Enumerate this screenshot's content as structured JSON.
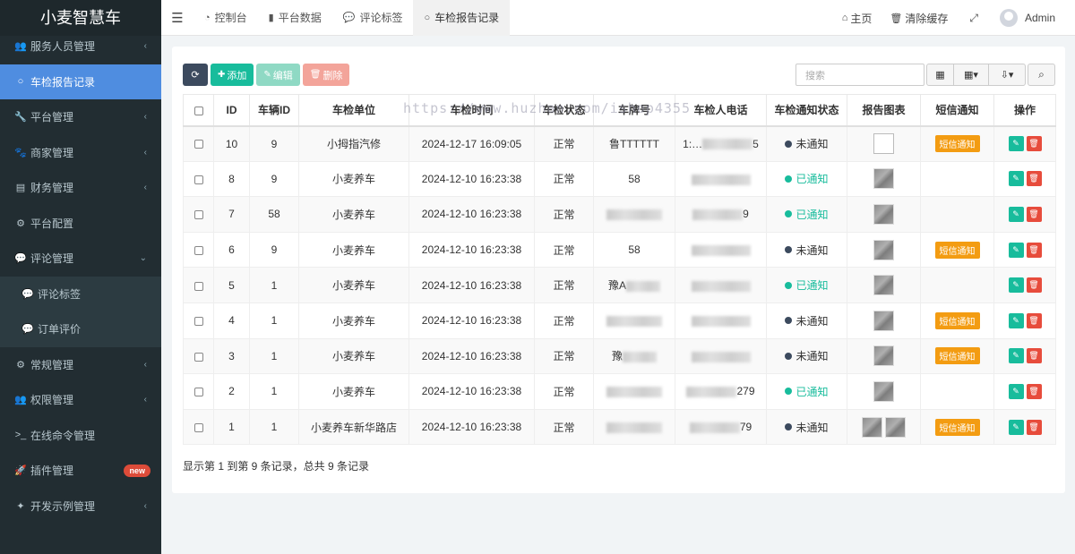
{
  "app": {
    "title": "小麦智慧车"
  },
  "sidebar": {
    "items": [
      {
        "label": "服务人员管理",
        "icon": "users-icon",
        "glyph": "👥",
        "arrow": true
      },
      {
        "label": "车检报告记录",
        "icon": "circle-icon",
        "glyph": "○",
        "active": true
      },
      {
        "label": "平台管理",
        "icon": "wrench-icon",
        "glyph": "🔧",
        "arrow": true
      },
      {
        "label": "商家管理",
        "icon": "paw-icon",
        "glyph": "🐾",
        "arrow": true
      },
      {
        "label": "财务管理",
        "icon": "money-icon",
        "glyph": "▤",
        "arrow": true
      },
      {
        "label": "平台配置",
        "icon": "cogs-icon",
        "glyph": "⚙"
      },
      {
        "label": "评论管理",
        "icon": "comments-icon",
        "glyph": "💬",
        "arrow": true,
        "expanded": true
      },
      {
        "label": "评论标签",
        "icon": "comments-icon",
        "glyph": "💬",
        "sub": true
      },
      {
        "label": "订单评价",
        "icon": "comment-icon",
        "glyph": "💬",
        "sub": true
      },
      {
        "label": "常规管理",
        "icon": "cogs-icon",
        "glyph": "⚙",
        "arrow": true
      },
      {
        "label": "权限管理",
        "icon": "group-icon",
        "glyph": "👥",
        "arrow": true
      },
      {
        "label": "在线命令管理",
        "icon": "terminal-icon",
        "glyph": ">_"
      },
      {
        "label": "插件管理",
        "icon": "rocket-icon",
        "glyph": "🚀",
        "badge": "new"
      },
      {
        "label": "开发示例管理",
        "icon": "magic-icon",
        "glyph": "✦",
        "arrow": true
      }
    ]
  },
  "header": {
    "tabs": [
      {
        "label": "控制台",
        "icon": "dashboard-icon",
        "glyph": "◔"
      },
      {
        "label": "平台数据",
        "icon": "bar-chart-icon",
        "glyph": "▮"
      },
      {
        "label": "评论标签",
        "icon": "comments-icon",
        "glyph": "💬"
      },
      {
        "label": "车检报告记录",
        "icon": "circle-icon",
        "glyph": "○",
        "active": true
      }
    ],
    "home_label": "主页",
    "clear_cache_label": "清除缓存",
    "user_name": "Admin"
  },
  "toolbar": {
    "add_label": "添加",
    "edit_label": "编辑",
    "delete_label": "删除",
    "search_placeholder": "搜索"
  },
  "watermark": "https://www.huzhan.com/ishop4355",
  "table": {
    "columns": [
      "ID",
      "车辆ID",
      "车检单位",
      "车检时间",
      "车检状态",
      "车牌号",
      "车检人电话",
      "车检通知状态",
      "报告图表",
      "短信通知",
      "操作"
    ],
    "rows": [
      {
        "id": "10",
        "car_id": "9",
        "unit": "小拇指汽修",
        "time": "2024-12-17 16:09:05",
        "status": "正常",
        "plate": "鲁TTTTTT",
        "plate_blur": false,
        "phone": "1:…",
        "phone_tail": "5",
        "notify": "未通知",
        "notified": false,
        "images": "broken",
        "sms": "短信通知"
      },
      {
        "id": "8",
        "car_id": "9",
        "unit": "小麦养车",
        "time": "2024-12-10 16:23:38",
        "status": "正常",
        "plate": "58",
        "plate_blur": false,
        "phone": "",
        "phone_tail": "",
        "notify": "已通知",
        "notified": true,
        "images": "1",
        "sms": ""
      },
      {
        "id": "7",
        "car_id": "58",
        "unit": "小麦养车",
        "time": "2024-12-10 16:23:38",
        "status": "正常",
        "plate": "",
        "plate_blur": true,
        "phone": "",
        "phone_tail": "9",
        "notify": "已通知",
        "notified": true,
        "images": "1",
        "sms": ""
      },
      {
        "id": "6",
        "car_id": "9",
        "unit": "小麦养车",
        "time": "2024-12-10 16:23:38",
        "status": "正常",
        "plate": "58",
        "plate_blur": false,
        "phone": "",
        "phone_tail": "",
        "notify": "未通知",
        "notified": false,
        "images": "1",
        "sms": "短信通知"
      },
      {
        "id": "5",
        "car_id": "1",
        "unit": "小麦养车",
        "time": "2024-12-10 16:23:38",
        "status": "正常",
        "plate": "豫A",
        "plate_blur": true,
        "phone": "",
        "phone_tail": "",
        "notify": "已通知",
        "notified": true,
        "images": "1",
        "sms": ""
      },
      {
        "id": "4",
        "car_id": "1",
        "unit": "小麦养车",
        "time": "2024-12-10 16:23:38",
        "status": "正常",
        "plate": "",
        "plate_blur": true,
        "phone": "",
        "phone_tail": "",
        "notify": "未通知",
        "notified": false,
        "images": "1",
        "sms": "短信通知"
      },
      {
        "id": "3",
        "car_id": "1",
        "unit": "小麦养车",
        "time": "2024-12-10 16:23:38",
        "status": "正常",
        "plate": "豫",
        "plate_blur": true,
        "phone": "",
        "phone_tail": "",
        "notify": "未通知",
        "notified": false,
        "images": "1",
        "sms": "短信通知"
      },
      {
        "id": "2",
        "car_id": "1",
        "unit": "小麦养车",
        "time": "2024-12-10 16:23:38",
        "status": "正常",
        "plate": "",
        "plate_blur": true,
        "phone": "",
        "phone_tail": "279",
        "notify": "已通知",
        "notified": true,
        "images": "1",
        "sms": ""
      },
      {
        "id": "1",
        "car_id": "1",
        "unit": "小麦养车新华路店",
        "time": "2024-12-10 16:23:38",
        "status": "正常",
        "plate": "",
        "plate_blur": true,
        "phone": "",
        "phone_tail": "79",
        "notify": "未通知",
        "notified": false,
        "images": "2",
        "sms": "短信通知"
      }
    ]
  },
  "pagination": {
    "summary": "显示第 1 到第 9 条记录，总共 9 条记录"
  },
  "colors": {
    "sidebar_bg": "#222d32",
    "active": "#4f8de0",
    "success": "#18bc9c",
    "danger": "#e74c3c",
    "warning": "#f39c12"
  }
}
